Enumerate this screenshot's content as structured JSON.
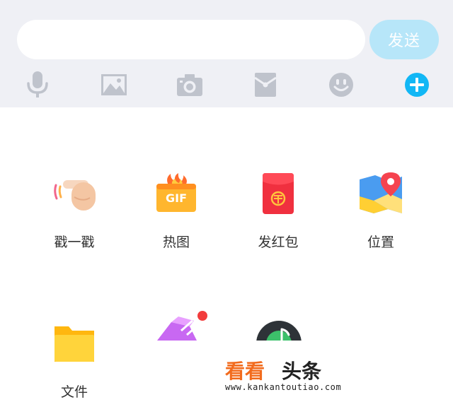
{
  "input_bar": {
    "message_value": "",
    "send_label": "发送"
  },
  "toolbar": {
    "icons": [
      "microphone-icon",
      "image-icon",
      "camera-icon",
      "red-packet-icon",
      "emoji-icon",
      "plus-icon"
    ]
  },
  "panel": {
    "items": [
      {
        "label": "戳一戳",
        "icon": "poke-icon"
      },
      {
        "label": "热图",
        "icon": "gif-icon"
      },
      {
        "label": "发红包",
        "icon": "red-envelope-icon"
      },
      {
        "label": "位置",
        "icon": "location-icon"
      },
      {
        "label": "文件",
        "icon": "folder-icon"
      }
    ]
  },
  "watermark": {
    "logo_text": "看看头条",
    "url": "www.kankantoutiao.com"
  },
  "colors": {
    "send_button": "#b7e6f9",
    "toolbar_icon": "#bfc3cc",
    "plus_accent": "#12b7f5",
    "notification_dot": "#f23c3c",
    "watermark_orange": "#f26b1d"
  }
}
